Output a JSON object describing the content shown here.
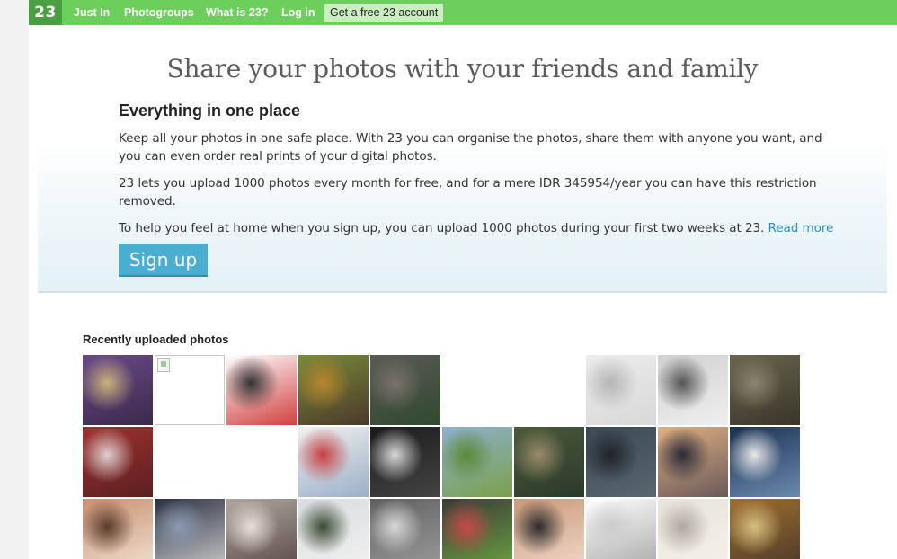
{
  "nav": {
    "logo": "23",
    "links": [
      "Just In",
      "Photogroups",
      "What is 23?",
      "Log in"
    ],
    "cta": "Get a free 23 account"
  },
  "hero": {
    "headline": "Share your photos with your friends and family",
    "subhead": "Everything in one place",
    "p1": "Keep all your photos in one safe place. With 23 you can organise the photos, share them with anyone you want, and you can even order real prints of your digital photos.",
    "p2": "23 lets you upload 1000 photos every month for free, and for a mere IDR 345954/year you can have this restriction removed.",
    "p3": "To help you feel at home when you sign up, you can upload 1000 photos during your first two weeks at 23.",
    "read_more": "Read more",
    "signup": "Sign up"
  },
  "recent": {
    "title": "Recently uploaded photos",
    "photos": [
      {
        "kind": "photo",
        "colors": [
          "#6a4a8a",
          "#c9b07a",
          "#3a2a4a"
        ]
      },
      {
        "kind": "broken"
      },
      {
        "kind": "photo",
        "colors": [
          "#ffffff",
          "#333333",
          "#d24040"
        ]
      },
      {
        "kind": "photo",
        "colors": [
          "#7a8a3a",
          "#b8862c",
          "#4a3a2a"
        ]
      },
      {
        "kind": "photo",
        "colors": [
          "#5a5a55",
          "#7a7268",
          "#2f4a2f"
        ]
      },
      {
        "kind": "blank"
      },
      {
        "kind": "blank"
      },
      {
        "kind": "photo",
        "colors": [
          "#ececec",
          "#b5b5b5",
          "#d8d8d8"
        ]
      },
      {
        "kind": "photo",
        "colors": [
          "#d0d0d0",
          "#555555",
          "#efefef"
        ]
      },
      {
        "kind": "photo",
        "colors": [
          "#6a6550",
          "#8a8570",
          "#3a3528"
        ]
      },
      {
        "kind": "photo",
        "colors": [
          "#a03030",
          "#e0d0d0",
          "#5a2020"
        ]
      },
      {
        "kind": "blank"
      },
      {
        "kind": "blank"
      },
      {
        "kind": "photo",
        "colors": [
          "#f0f0f0",
          "#c84040",
          "#9ab0c8"
        ]
      },
      {
        "kind": "photo",
        "colors": [
          "#1a1a1a",
          "#d8d8d8",
          "#444444"
        ]
      },
      {
        "kind": "photo",
        "colors": [
          "#8fb0d0",
          "#5a8a3a",
          "#7aa04a"
        ]
      },
      {
        "kind": "photo",
        "colors": [
          "#4a5a3a",
          "#9a8a6a",
          "#2a3a2a"
        ]
      },
      {
        "kind": "photo",
        "colors": [
          "#3a4a55",
          "#202428",
          "#5a6670"
        ]
      },
      {
        "kind": "photo",
        "colors": [
          "#e0b080",
          "#2a2a3a",
          "#6a5a5a"
        ]
      },
      {
        "kind": "photo",
        "colors": [
          "#1c3050",
          "#e8e8e8",
          "#6a8ab0"
        ]
      },
      {
        "kind": "photo",
        "colors": [
          "#c89070",
          "#5a3a2a",
          "#f0e0d0"
        ]
      },
      {
        "kind": "photo",
        "colors": [
          "#2a3040",
          "#8a9ab0",
          "#c8c8c8"
        ]
      },
      {
        "kind": "photo",
        "colors": [
          "#b0a8a0",
          "#e8e0d8",
          "#5a4a48"
        ]
      },
      {
        "kind": "photo",
        "colors": [
          "#d8dde0",
          "#3a4a30",
          "#f0f0f0"
        ]
      },
      {
        "kind": "photo",
        "colors": [
          "#606060",
          "#d8d8d8",
          "#9a9a9a"
        ]
      },
      {
        "kind": "photo",
        "colors": [
          "#3a3a38",
          "#c84848",
          "#6aa040"
        ]
      },
      {
        "kind": "photo",
        "colors": [
          "#c89878",
          "#2a2a2a",
          "#f0d8c8"
        ]
      },
      {
        "kind": "photo",
        "colors": [
          "#ffffff",
          "#cccccc",
          "#aaaaaa"
        ]
      },
      {
        "kind": "photo",
        "colors": [
          "#e8e4dc",
          "#b0a8a0",
          "#f5f0e8"
        ]
      },
      {
        "kind": "photo",
        "colors": [
          "#a07030",
          "#d8c080",
          "#4a3a2a"
        ]
      }
    ]
  }
}
